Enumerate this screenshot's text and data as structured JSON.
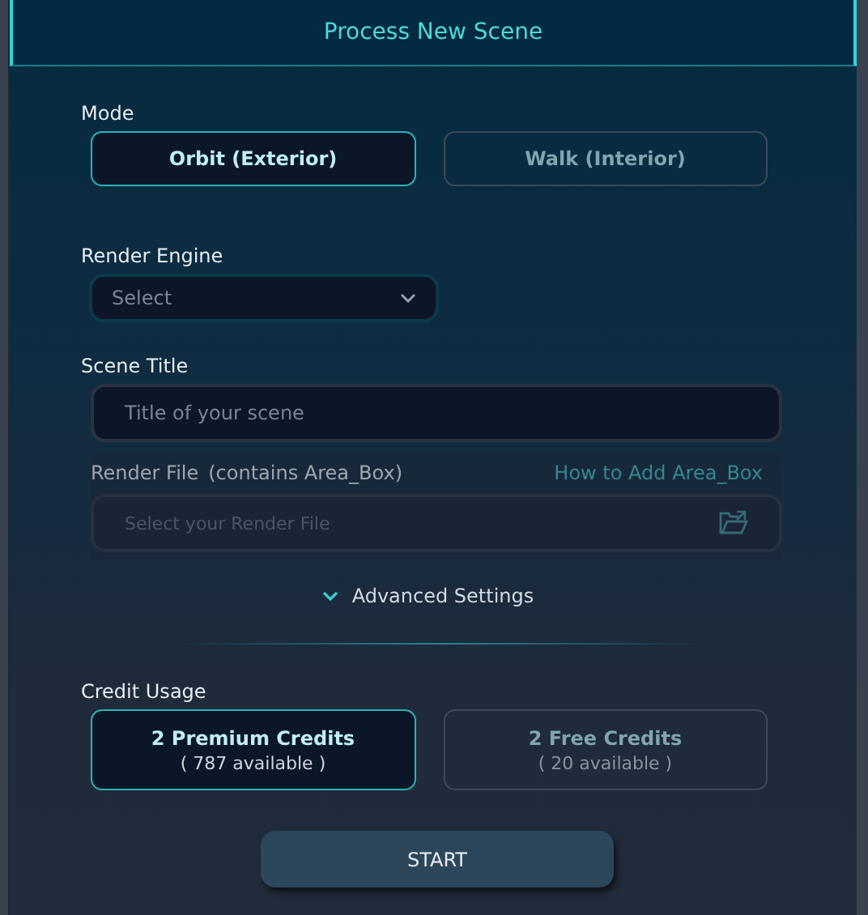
{
  "header": {
    "title": "Process New Scene"
  },
  "mode": {
    "label": "Mode",
    "options": [
      {
        "label": "Orbit (Exterior)",
        "selected": true
      },
      {
        "label": "Walk (Interior)",
        "selected": false
      }
    ]
  },
  "render_engine": {
    "label": "Render Engine",
    "placeholder": "Select"
  },
  "scene_title": {
    "label": "Scene Title",
    "placeholder": "Title of your scene"
  },
  "render_file": {
    "label": "Render File",
    "note": "(contains Area_Box)",
    "link": "How to Add Area_Box",
    "placeholder": "Select your Render File",
    "disabled": true
  },
  "advanced": {
    "label": "Advanced Settings",
    "expanded": false
  },
  "credits": {
    "label": "Credit Usage",
    "options": [
      {
        "title": "2 Premium Credits",
        "subtitle": "( 787 available )",
        "selected": true
      },
      {
        "title": "2 Free Credits",
        "subtitle": "( 20 available )",
        "selected": false
      }
    ]
  },
  "start_button": "START"
}
